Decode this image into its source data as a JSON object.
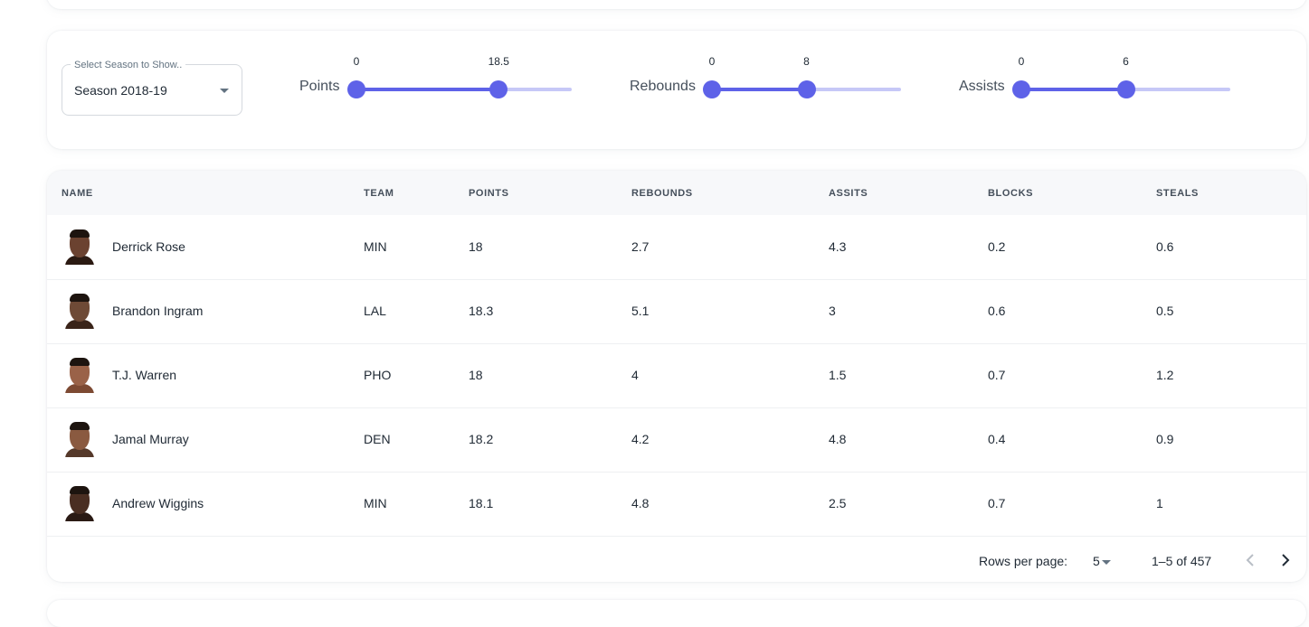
{
  "season_select": {
    "label": "Select Season to Show..",
    "value": "Season 2018-19"
  },
  "filters": [
    {
      "label": "Points",
      "min": 0,
      "max": 18.5,
      "range_max": 28,
      "min_label": "0",
      "max_label": "18.5"
    },
    {
      "label": "Rebounds",
      "min": 0,
      "max": 8,
      "range_max": 16,
      "min_label": "0",
      "max_label": "8"
    },
    {
      "label": "Assists",
      "min": 0,
      "max": 6,
      "range_max": 12,
      "min_label": "0",
      "max_label": "6"
    }
  ],
  "table": {
    "columns": [
      "NAME",
      "TEAM",
      "POINTS",
      "REBOUNDS",
      "ASSITS",
      "BLOCKS",
      "STEALS"
    ],
    "rows": [
      {
        "name": "Derrick Rose",
        "team": "MIN",
        "points": "18",
        "rebounds": "2.7",
        "assists": "4.3",
        "blocks": "0.2",
        "steals": "0.6"
      },
      {
        "name": "Brandon Ingram",
        "team": "LAL",
        "points": "18.3",
        "rebounds": "5.1",
        "assists": "3",
        "blocks": "0.6",
        "steals": "0.5"
      },
      {
        "name": "T.J. Warren",
        "team": "PHO",
        "points": "18",
        "rebounds": "4",
        "assists": "1.5",
        "blocks": "0.7",
        "steals": "1.2"
      },
      {
        "name": "Jamal Murray",
        "team": "DEN",
        "points": "18.2",
        "rebounds": "4.2",
        "assists": "4.8",
        "blocks": "0.4",
        "steals": "0.9"
      },
      {
        "name": "Andrew Wiggins",
        "team": "MIN",
        "points": "18.1",
        "rebounds": "4.8",
        "assists": "2.5",
        "blocks": "0.7",
        "steals": "1"
      }
    ]
  },
  "pagination": {
    "rows_per_page_label": "Rows per page:",
    "rows_per_page": "5",
    "range_text": "1–5 of 457",
    "prev_icon": "chevron-left-icon",
    "next_icon": "chevron-right-icon"
  },
  "colors": {
    "accent": "#5e62e8",
    "track": "#c6c8f7"
  }
}
